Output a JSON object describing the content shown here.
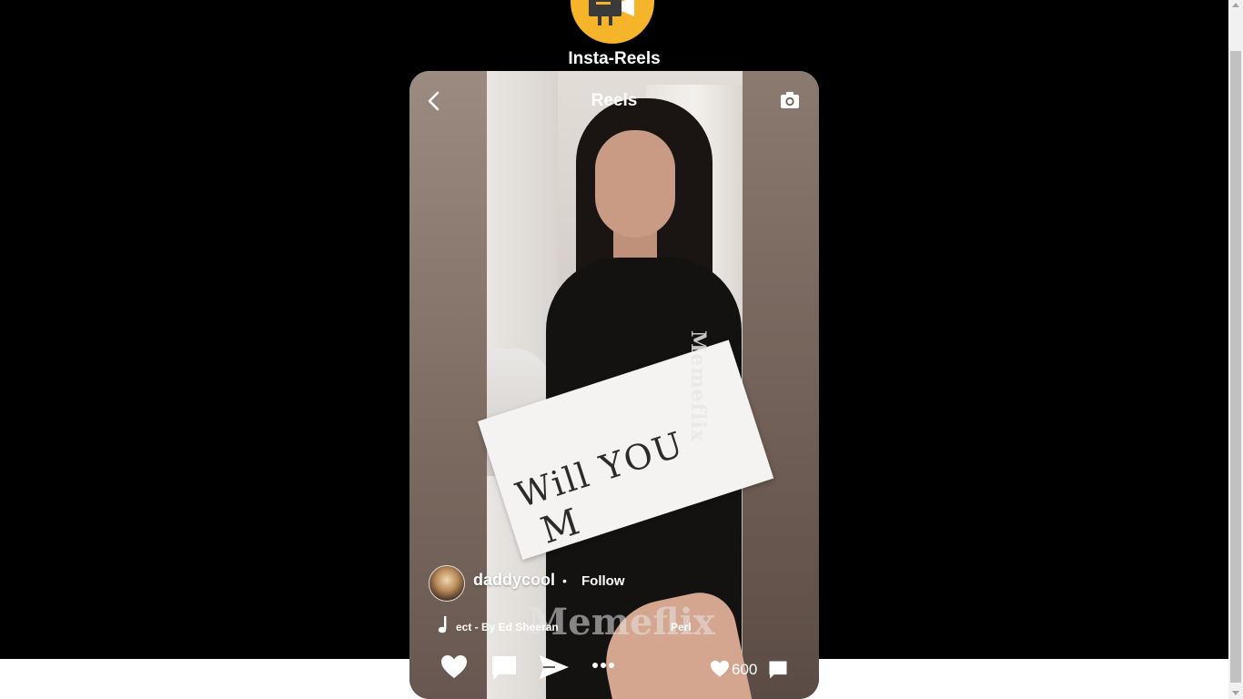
{
  "app": {
    "title": "Insta-Reels"
  },
  "reel_header": {
    "title": "Reels"
  },
  "video": {
    "overlay_watermark": "Memeflix",
    "handwritten_line_1": "Will YOU",
    "handwritten_line_2": "M"
  },
  "post": {
    "username": "daddycool",
    "separator": "•",
    "follow_label": "Follow",
    "music_text": "ect - By Ed Sheeran",
    "music_text_2": "Perl"
  },
  "stats": {
    "likes": "600"
  },
  "icons": {
    "logo": "film-projector-icon",
    "back": "chevron-left-icon",
    "camera": "camera-icon",
    "music": "music-note-icon",
    "like": "heart-icon",
    "comment": "comment-icon",
    "share": "send-icon",
    "more": "more-dots-icon"
  },
  "colors": {
    "page_background": "#000000",
    "logo_background": "#f6b42a",
    "text": "#ffffff"
  }
}
